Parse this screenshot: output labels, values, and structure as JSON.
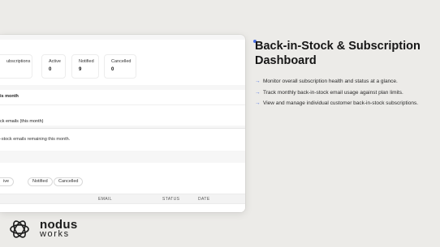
{
  "stats": {
    "subscriptions_label": "ubscriptions",
    "active_label": "Active",
    "active_value": "0",
    "notified_label": "Notified",
    "notified_value": "9",
    "cancelled_label": "Cancelled",
    "cancelled_value": "0"
  },
  "usage": {
    "title_fragment": "is month",
    "emails_fragment": "ck emails (this month)"
  },
  "remaining": {
    "text": "-stock emails remaining this month."
  },
  "subscriptions": {
    "filters": [
      "ive",
      "Notified",
      "Cancelled"
    ],
    "columns": {
      "email": "EMAIL",
      "status": "STATUS",
      "date": "DATE"
    }
  },
  "info": {
    "title": "Back-in-Stock & Subscription Dashboard",
    "bullets": [
      "Monitor overall subscription health and status at a glance.",
      "Track monthly back-in-stock email usage against plan limits.",
      "View and manage individual customer back-in-stock subscriptions."
    ],
    "accent": "#4a6fe3"
  },
  "brand": {
    "line1": "nodus",
    "line2": "works"
  }
}
